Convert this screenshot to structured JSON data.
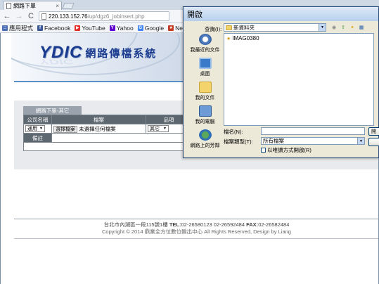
{
  "browser": {
    "tab_title": "網路下單",
    "tab_close": "×",
    "nav": {
      "back": "←",
      "forward": "→",
      "reload": "C",
      "home": "⌂"
    },
    "url_host": "220.133.152.76",
    "url_path": "/up/dgz6_jobinsert.php"
  },
  "bookmarks": [
    {
      "label": "應用程式",
      "icon": "apps-icon",
      "color": "#4a6fb5",
      "glyph": "::"
    },
    {
      "label": "Facebook",
      "icon": "facebook-icon",
      "color": "#3b5998",
      "glyph": "f"
    },
    {
      "label": "YouTube",
      "icon": "youtube-icon",
      "color": "#e52d27",
      "glyph": "▶"
    },
    {
      "label": "Yahoo",
      "icon": "yahoo-icon",
      "color": "#5f01d1",
      "glyph": "Y"
    },
    {
      "label": "Google",
      "icon": "google-icon",
      "color": "#4285f4",
      "glyph": "G"
    },
    {
      "label": "Ne",
      "icon": "bookmark-icon",
      "color": "#c23b22",
      "glyph": "★"
    }
  ],
  "banner": {
    "logo_text": "YDIC",
    "logo_cn": "網路傳檔系統"
  },
  "form": {
    "tab_label": "網路下單-其它",
    "headers": [
      "公司名稱",
      "檔案",
      "品項"
    ],
    "company_select": "通用",
    "file_button": "選擇檔案",
    "file_status": "未選擇任何檔案",
    "item_select": "其它",
    "note_label": "備註"
  },
  "footer": {
    "line1_addr": "台北市內湖區一段115號1樓",
    "tel_label": "TEL:",
    "tel": "02-26580123 02-26592484",
    "fax_label": "FAX:",
    "fax": "02-26582484",
    "line2": "Copyright © 2014 鼎業全方位數位輸出中心 All Rights Reserved, Design by Liang"
  },
  "dialog": {
    "title": "開啟",
    "lookin_label": "查詢(I):",
    "lookin_value": "新資料夾",
    "places": [
      "我最近的文件",
      "桌面",
      "我的文件",
      "我的電腦",
      "網路上的芳鄰"
    ],
    "files": [
      "IMAG0380"
    ],
    "filename_label": "檔名(N):",
    "filename_value": "",
    "filetype_label": "檔案類型(T):",
    "filetype_value": "所有檔案",
    "readonly_label": "以唯讀方式開啟(R)",
    "open_button": "開",
    "cancel_button": ""
  }
}
